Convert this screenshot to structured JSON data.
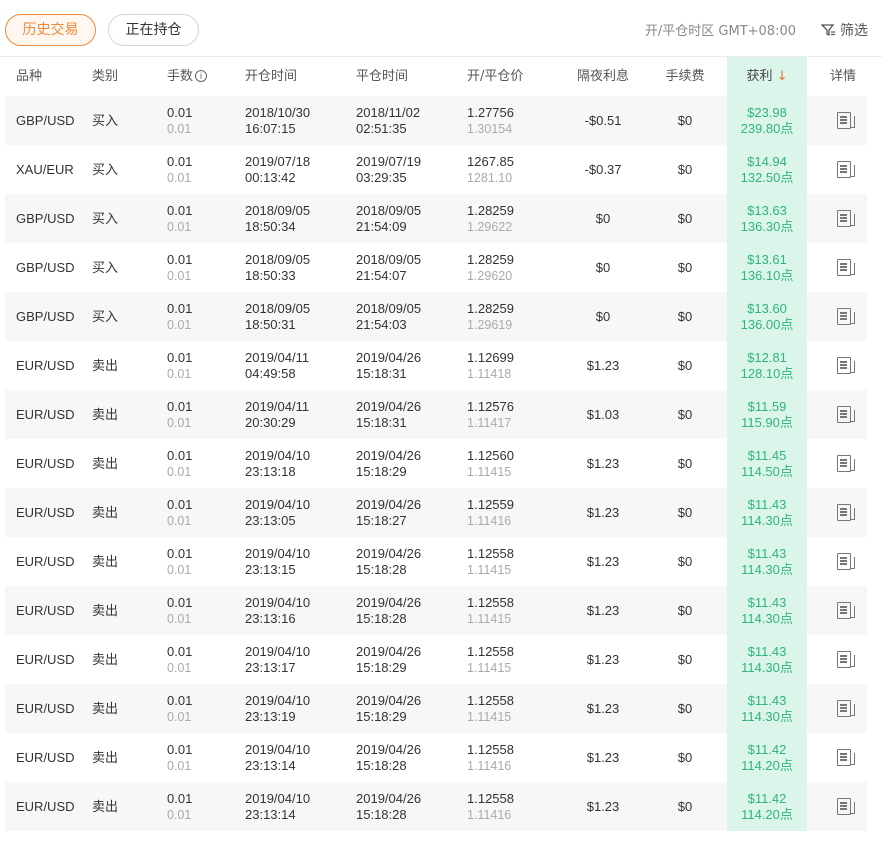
{
  "tabs": {
    "history": "历史交易",
    "holding": "正在持仓"
  },
  "timezone": "开/平仓时区 GMT+08:00",
  "filter_label": "筛选",
  "columns": {
    "symbol": "品种",
    "type": "类别",
    "lots": "手数",
    "open_time": "开仓时间",
    "close_time": "平仓时间",
    "price": "开/平仓价",
    "swap": "隔夜利息",
    "commission": "手续费",
    "profit": "获利",
    "profit_sort": "↓",
    "detail": "详情"
  },
  "colors": {
    "accent": "#f08a3c",
    "profit": "#2fb47d",
    "profit_bg": "#dcf5ea"
  },
  "rows": [
    {
      "symbol": "GBP/USD",
      "type": "买入",
      "lots": "0.01",
      "lots2": "0.01",
      "open_date": "2018/10/30",
      "open_time": "16:07:15",
      "close_date": "2018/11/02",
      "close_time": "02:51:35",
      "open_price": "1.27756",
      "close_price": "1.30154",
      "swap": "-$0.51",
      "commission": "$0",
      "profit": "$23.98",
      "points": "239.80点"
    },
    {
      "symbol": "XAU/EUR",
      "type": "买入",
      "lots": "0.01",
      "lots2": "0.01",
      "open_date": "2019/07/18",
      "open_time": "00:13:42",
      "close_date": "2019/07/19",
      "close_time": "03:29:35",
      "open_price": "1267.85",
      "close_price": "1281.10",
      "swap": "-$0.37",
      "commission": "$0",
      "profit": "$14.94",
      "points": "132.50点"
    },
    {
      "symbol": "GBP/USD",
      "type": "买入",
      "lots": "0.01",
      "lots2": "0.01",
      "open_date": "2018/09/05",
      "open_time": "18:50:34",
      "close_date": "2018/09/05",
      "close_time": "21:54:09",
      "open_price": "1.28259",
      "close_price": "1.29622",
      "swap": "$0",
      "commission": "$0",
      "profit": "$13.63",
      "points": "136.30点"
    },
    {
      "symbol": "GBP/USD",
      "type": "买入",
      "lots": "0.01",
      "lots2": "0.01",
      "open_date": "2018/09/05",
      "open_time": "18:50:33",
      "close_date": "2018/09/05",
      "close_time": "21:54:07",
      "open_price": "1.28259",
      "close_price": "1.29620",
      "swap": "$0",
      "commission": "$0",
      "profit": "$13.61",
      "points": "136.10点"
    },
    {
      "symbol": "GBP/USD",
      "type": "买入",
      "lots": "0.01",
      "lots2": "0.01",
      "open_date": "2018/09/05",
      "open_time": "18:50:31",
      "close_date": "2018/09/05",
      "close_time": "21:54:03",
      "open_price": "1.28259",
      "close_price": "1.29619",
      "swap": "$0",
      "commission": "$0",
      "profit": "$13.60",
      "points": "136.00点"
    },
    {
      "symbol": "EUR/USD",
      "type": "卖出",
      "lots": "0.01",
      "lots2": "0.01",
      "open_date": "2019/04/11",
      "open_time": "04:49:58",
      "close_date": "2019/04/26",
      "close_time": "15:18:31",
      "open_price": "1.12699",
      "close_price": "1.11418",
      "swap": "$1.23",
      "commission": "$0",
      "profit": "$12.81",
      "points": "128.10点"
    },
    {
      "symbol": "EUR/USD",
      "type": "卖出",
      "lots": "0.01",
      "lots2": "0.01",
      "open_date": "2019/04/11",
      "open_time": "20:30:29",
      "close_date": "2019/04/26",
      "close_time": "15:18:31",
      "open_price": "1.12576",
      "close_price": "1.11417",
      "swap": "$1.03",
      "commission": "$0",
      "profit": "$11.59",
      "points": "115.90点"
    },
    {
      "symbol": "EUR/USD",
      "type": "卖出",
      "lots": "0.01",
      "lots2": "0.01",
      "open_date": "2019/04/10",
      "open_time": "23:13:18",
      "close_date": "2019/04/26",
      "close_time": "15:18:29",
      "open_price": "1.12560",
      "close_price": "1.11415",
      "swap": "$1.23",
      "commission": "$0",
      "profit": "$11.45",
      "points": "114.50点"
    },
    {
      "symbol": "EUR/USD",
      "type": "卖出",
      "lots": "0.01",
      "lots2": "0.01",
      "open_date": "2019/04/10",
      "open_time": "23:13:05",
      "close_date": "2019/04/26",
      "close_time": "15:18:27",
      "open_price": "1.12559",
      "close_price": "1.11416",
      "swap": "$1.23",
      "commission": "$0",
      "profit": "$11.43",
      "points": "114.30点"
    },
    {
      "symbol": "EUR/USD",
      "type": "卖出",
      "lots": "0.01",
      "lots2": "0.01",
      "open_date": "2019/04/10",
      "open_time": "23:13:15",
      "close_date": "2019/04/26",
      "close_time": "15:18:28",
      "open_price": "1.12558",
      "close_price": "1.11415",
      "swap": "$1.23",
      "commission": "$0",
      "profit": "$11.43",
      "points": "114.30点"
    },
    {
      "symbol": "EUR/USD",
      "type": "卖出",
      "lots": "0.01",
      "lots2": "0.01",
      "open_date": "2019/04/10",
      "open_time": "23:13:16",
      "close_date": "2019/04/26",
      "close_time": "15:18:28",
      "open_price": "1.12558",
      "close_price": "1.11415",
      "swap": "$1.23",
      "commission": "$0",
      "profit": "$11.43",
      "points": "114.30点"
    },
    {
      "symbol": "EUR/USD",
      "type": "卖出",
      "lots": "0.01",
      "lots2": "0.01",
      "open_date": "2019/04/10",
      "open_time": "23:13:17",
      "close_date": "2019/04/26",
      "close_time": "15:18:29",
      "open_price": "1.12558",
      "close_price": "1.11415",
      "swap": "$1.23",
      "commission": "$0",
      "profit": "$11.43",
      "points": "114.30点"
    },
    {
      "symbol": "EUR/USD",
      "type": "卖出",
      "lots": "0.01",
      "lots2": "0.01",
      "open_date": "2019/04/10",
      "open_time": "23:13:19",
      "close_date": "2019/04/26",
      "close_time": "15:18:29",
      "open_price": "1.12558",
      "close_price": "1.11415",
      "swap": "$1.23",
      "commission": "$0",
      "profit": "$11.43",
      "points": "114.30点"
    },
    {
      "symbol": "EUR/USD",
      "type": "卖出",
      "lots": "0.01",
      "lots2": "0.01",
      "open_date": "2019/04/10",
      "open_time": "23:13:14",
      "close_date": "2019/04/26",
      "close_time": "15:18:28",
      "open_price": "1.12558",
      "close_price": "1.11416",
      "swap": "$1.23",
      "commission": "$0",
      "profit": "$11.42",
      "points": "114.20点"
    },
    {
      "symbol": "EUR/USD",
      "type": "卖出",
      "lots": "0.01",
      "lots2": "0.01",
      "open_date": "2019/04/10",
      "open_time": "23:13:14",
      "close_date": "2019/04/26",
      "close_time": "15:18:28",
      "open_price": "1.12558",
      "close_price": "1.11416",
      "swap": "$1.23",
      "commission": "$0",
      "profit": "$11.42",
      "points": "114.20点"
    }
  ]
}
